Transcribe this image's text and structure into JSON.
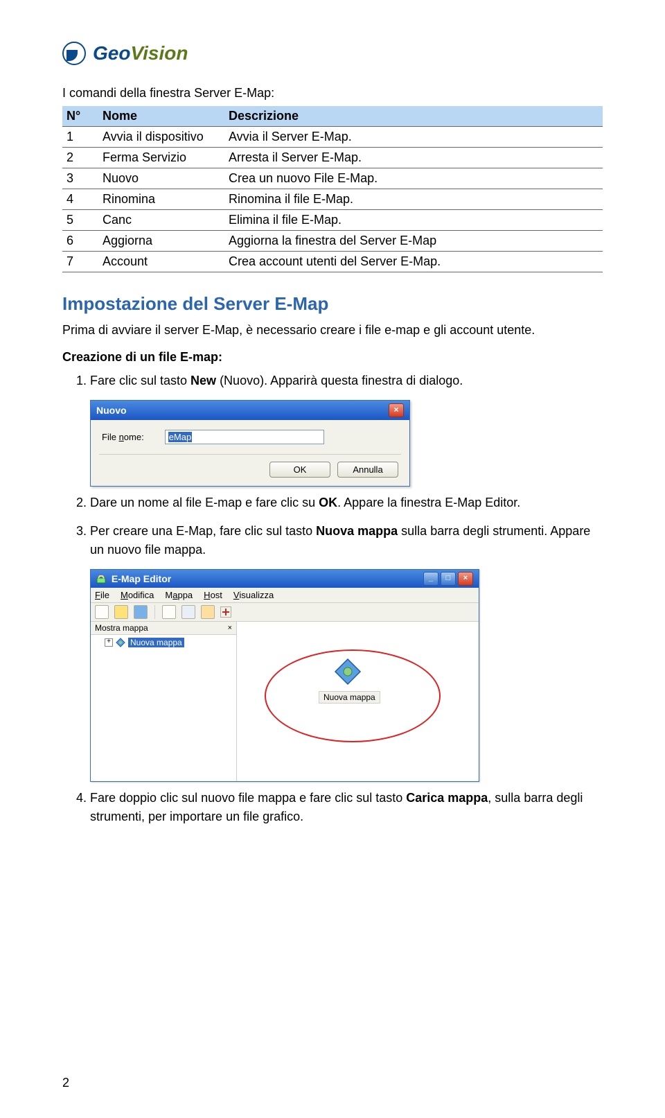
{
  "logo": {
    "geo": "Geo",
    "vision": "Vision"
  },
  "intro": "I comandi della finestra Server E-Map:",
  "table": {
    "headers": [
      "N°",
      "Nome",
      "Descrizione"
    ],
    "rows": [
      [
        "1",
        "Avvia il dispositivo",
        "Avvia il Server E-Map."
      ],
      [
        "2",
        "Ferma Servizio",
        "Arresta il Server E-Map."
      ],
      [
        "3",
        "Nuovo",
        "Crea un nuovo File E-Map."
      ],
      [
        "4",
        "Rinomina",
        "Rinomina il file E-Map."
      ],
      [
        "5",
        "Canc",
        "Elimina il file E-Map."
      ],
      [
        "6",
        "Aggiorna",
        "Aggiorna la finestra del Server E-Map"
      ],
      [
        "7",
        "Account",
        "Crea account utenti del Server E-Map."
      ]
    ]
  },
  "section_title": "Impostazione del Server E-Map",
  "section_intro": "Prima di avviare il server E-Map, è necessario creare i file e-map e gli account utente.",
  "subheading": "Creazione di un file E-map:",
  "steps": {
    "s1a": "Fare clic sul tasto ",
    "s1b": "New",
    "s1c": " (Nuovo). Apparirà questa finestra di dialogo.",
    "s2a": "Dare un nome al file E-map e fare clic su ",
    "s2b": "OK",
    "s2c": ". Appare la finestra E-Map Editor.",
    "s3a": "Per creare una E-Map, fare clic sul tasto ",
    "s3b": "Nuova mappa",
    "s3c": " sulla barra degli strumenti. Appare un nuovo file mappa.",
    "s4a": "Fare doppio clic sul nuovo file mappa e fare clic sul tasto ",
    "s4b": "Carica mappa",
    "s4c": ", sulla barra degli strumenti, per importare un file grafico."
  },
  "dialog_nuovo": {
    "title": "Nuovo",
    "label_html": "File <span class='u'>n</span>ome:",
    "value": "eMap",
    "ok": "OK",
    "cancel": "Annulla"
  },
  "editor": {
    "title": "E-Map Editor",
    "menus_html": [
      "<span class='u'>F</span>ile",
      "<span class='u'>M</span>odifica",
      "M<span class='u'>a</span>ppa",
      "<span class='u'>H</span>ost",
      "<span class='u'>V</span>isualizza"
    ],
    "tree_tab": "Mostra mappa",
    "tree_item": "Nuova mappa",
    "canvas_caption": "Nuova mappa"
  },
  "page_number": "2"
}
